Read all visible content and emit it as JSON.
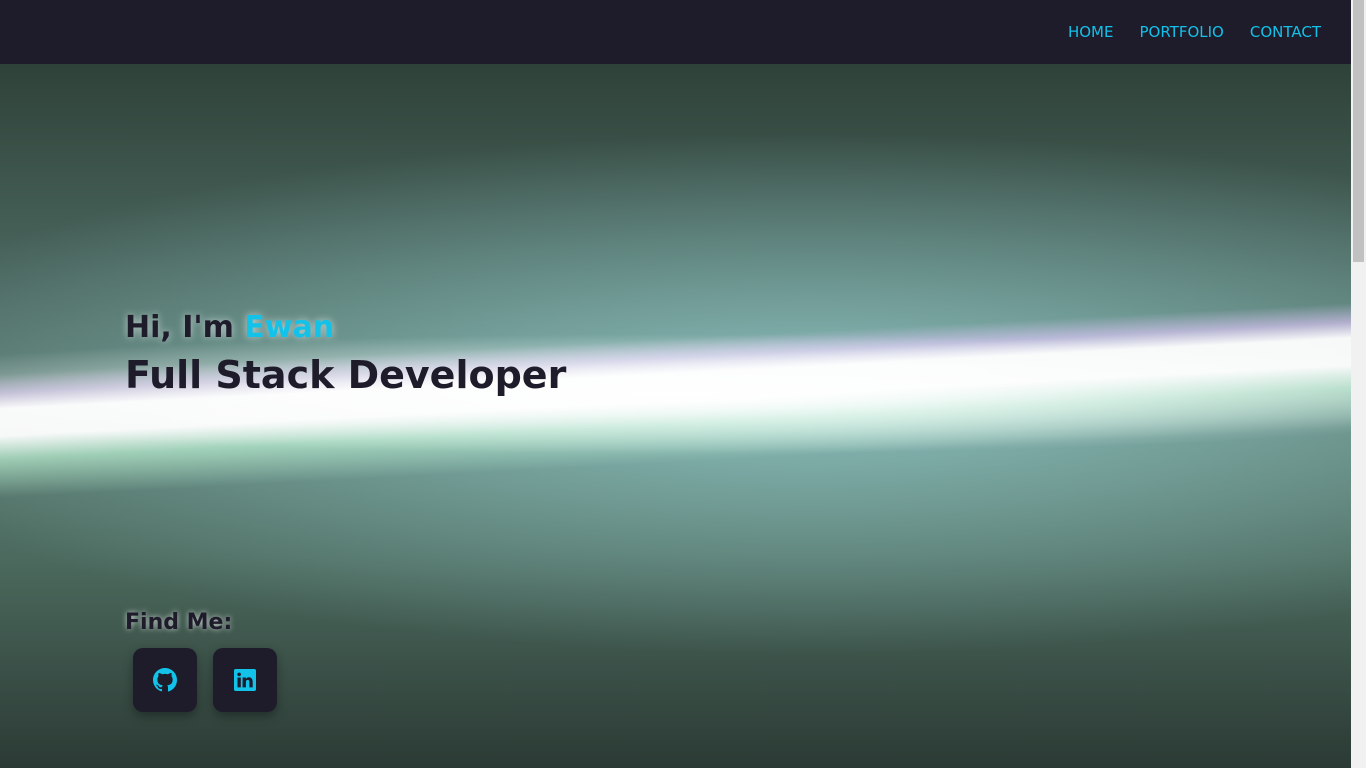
{
  "nav": {
    "items": [
      {
        "label": "HOME"
      },
      {
        "label": "PORTFOLIO"
      },
      {
        "label": "CONTACT"
      }
    ]
  },
  "hero": {
    "greeting": "Hi, I'm ",
    "name": "Ewan",
    "role": "Full Stack Developer"
  },
  "social": {
    "heading": "Find Me:",
    "links": [
      {
        "icon": "github-icon"
      },
      {
        "icon": "linkedin-icon"
      }
    ]
  },
  "colors": {
    "accent": "#12c2e9",
    "dark": "#1e1b2b"
  }
}
